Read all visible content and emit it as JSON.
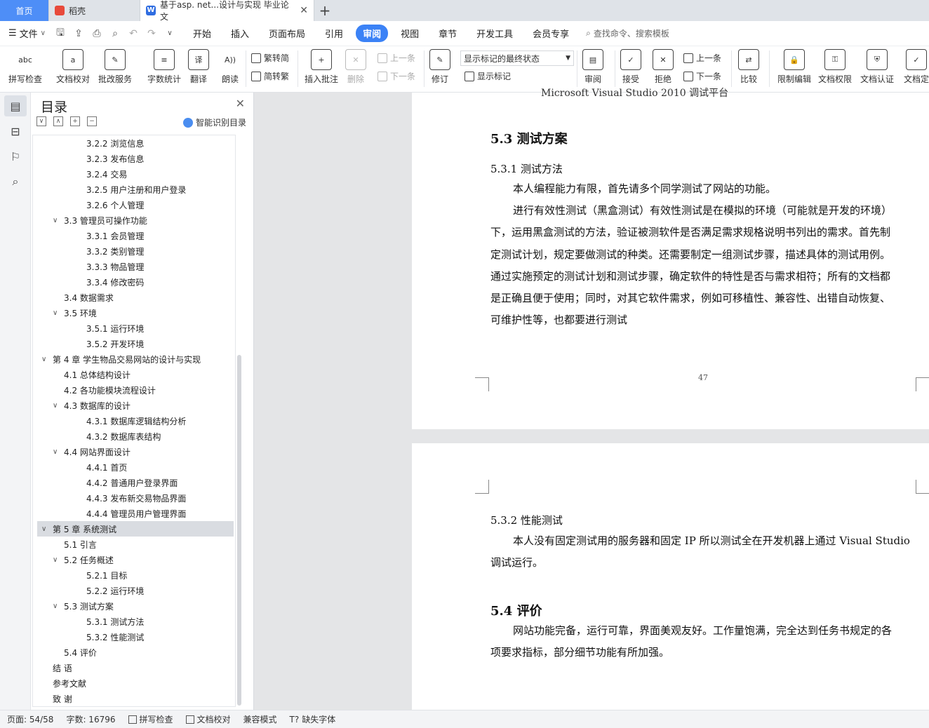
{
  "tabs": {
    "home": "首页",
    "shell": "稻壳",
    "doc": "基于asp. net...设计与实现 毕业论文"
  },
  "menu": {
    "file": "文件",
    "items": [
      "开始",
      "插入",
      "页面布局",
      "引用",
      "审阅",
      "视图",
      "章节",
      "开发工具",
      "会员专享"
    ],
    "active": "审阅",
    "search": "查找命令、搜索模板"
  },
  "ribbon": {
    "spell": "拼写检查",
    "proof": "文档校对",
    "batch": "批改服务",
    "count": "字数统计",
    "translate": "翻译",
    "read": "朗读",
    "trad": "繁转简",
    "simp": "简转繁",
    "insert_comment": "插入批注",
    "delete": "删除",
    "prev": "上一条",
    "next": "下一条",
    "track": "修订",
    "display_state": "显示标记的最终状态",
    "show_marks": "显示标记",
    "review": "审阅",
    "accept": "接受",
    "reject": "拒绝",
    "prev2": "上一条",
    "next2": "下一条",
    "compare": "比较",
    "restrict": "限制编辑",
    "rights": "文档权限",
    "auth": "文档认证",
    "final": "文档定"
  },
  "toc": {
    "title": "目录",
    "smart": "智能识别目录",
    "items": [
      {
        "text": "3.2.2 浏览信息",
        "level": 3,
        "arrow": ""
      },
      {
        "text": "3.2.3 发布信息",
        "level": 3,
        "arrow": ""
      },
      {
        "text": "3.2.4  交易",
        "level": 3,
        "arrow": ""
      },
      {
        "text": "3.2.5 用户注册和用户登录",
        "level": 3,
        "arrow": ""
      },
      {
        "text": "3.2.6 个人管理",
        "level": 3,
        "arrow": ""
      },
      {
        "text": "3.3 管理员可操作功能",
        "level": 2,
        "arrow": "∨"
      },
      {
        "text": "3.3.1 会员管理",
        "level": 3,
        "arrow": ""
      },
      {
        "text": "3.3.2 类别管理",
        "level": 3,
        "arrow": ""
      },
      {
        "text": "3.3.3 物品管理",
        "level": 3,
        "arrow": ""
      },
      {
        "text": "3.3.4  修改密码",
        "level": 3,
        "arrow": ""
      },
      {
        "text": "3.4 数据需求",
        "level": 2,
        "arrow": ""
      },
      {
        "text": "3.5 环境",
        "level": 2,
        "arrow": "∨"
      },
      {
        "text": "3.5.1 运行环境",
        "level": 3,
        "arrow": ""
      },
      {
        "text": "3.5.2 开发环境",
        "level": 3,
        "arrow": ""
      },
      {
        "text": "第 4 章  学生物品交易网站的设计与实现",
        "level": 1,
        "arrow": "∨"
      },
      {
        "text": "4.1 总体结构设计",
        "level": 2,
        "arrow": ""
      },
      {
        "text": "4.2 各功能模块流程设计",
        "level": 2,
        "arrow": ""
      },
      {
        "text": "4.3 数据库的设计",
        "level": 2,
        "arrow": "∨"
      },
      {
        "text": "4.3.1 数据库逻辑结构分析",
        "level": 3,
        "arrow": ""
      },
      {
        "text": "4.3.2 数据库表结构",
        "level": 3,
        "arrow": ""
      },
      {
        "text": "4.4 网站界面设计",
        "level": 2,
        "arrow": "∨"
      },
      {
        "text": "4.4.1 首页",
        "level": 3,
        "arrow": ""
      },
      {
        "text": "4.4.2 普通用户登录界面",
        "level": 3,
        "arrow": ""
      },
      {
        "text": "4.4.3 发布新交易物品界面",
        "level": 3,
        "arrow": ""
      },
      {
        "text": "4.4.4 管理员用户管理界面",
        "level": 3,
        "arrow": ""
      },
      {
        "text": "第 5 章  系统测试",
        "level": 1,
        "arrow": "∨"
      },
      {
        "text": "5.1  引言",
        "level": 2,
        "arrow": ""
      },
      {
        "text": "5.2  任务概述",
        "level": 2,
        "arrow": "∨"
      },
      {
        "text": "5.2.1  目标",
        "level": 3,
        "arrow": ""
      },
      {
        "text": "5.2.2  运行环境",
        "level": 3,
        "arrow": ""
      },
      {
        "text": "5.3  测试方案",
        "level": 2,
        "arrow": "∨"
      },
      {
        "text": "5.3.1  测试方法",
        "level": 3,
        "arrow": ""
      },
      {
        "text": "5.3.2  性能测试",
        "level": 3,
        "arrow": ""
      },
      {
        "text": "5.4  评价",
        "level": 2,
        "arrow": ""
      },
      {
        "text": "结   语",
        "level": 1,
        "arrow": ""
      },
      {
        "text": "参考文献",
        "level": 1,
        "arrow": ""
      },
      {
        "text": "致   谢",
        "level": 1,
        "arrow": ""
      }
    ],
    "selected_index": 25
  },
  "document": {
    "cut_line": "Microsoft Visual Studio 2010 调试平台",
    "h53": "5.3  测试方案",
    "h531": "5.3.1  测试方法",
    "p1": "本人编程能力有限，首先请多个同学测试了网站的功能。",
    "p2_lines": [
      "进行有效性测试（黑盒测试）有效性测试是在模拟的环境（可能就是开发的环境）",
      "下，运用黑盒测试的方法，验证被测软件是否满足需求规格说明书列出的需求。首先制",
      "定测试计划，规定要做测试的种类。还需要制定一组测试步骤，描述具体的测试用例。",
      "通过实施预定的测试计划和测试步骤，确定软件的特性是否与需求相符；所有的文档都",
      "是正确且便于使用；同时，对其它软件需求，例如可移植性、兼容性、出错自动恢复、",
      "可维护性等，也都要进行测试"
    ],
    "page_no": "47",
    "h532": "5.3.2  性能测试",
    "p3_lines": [
      "本人没有固定测试用的服务器和固定 IP 所以测试全在开发机器上通过 Visual Studio",
      "调试运行。"
    ],
    "h54": "5.4  评价",
    "p4_lines": [
      "网站功能完备，运行可靠，界面美观友好。工作量饱满，完全达到任务书规定的各",
      "项要求指标，部分细节功能有所加强。"
    ]
  },
  "status": {
    "page": "页面: 54/58",
    "words": "字数: 16796",
    "spell": "拼写检查",
    "proof": "文档校对",
    "compat": "兼容模式",
    "missing_font": "缺失字体"
  },
  "colors": {
    "accent": "#3b82f6",
    "home_tab": "#4e8ef7",
    "toc_selected": "#d9dce1"
  }
}
